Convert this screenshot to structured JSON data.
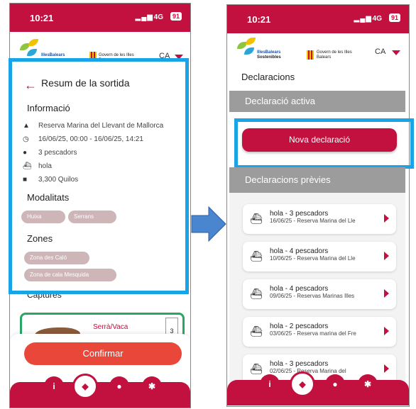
{
  "colors": {
    "brand": "#c2103f",
    "highlight": "#1aa3e6",
    "grey_header": "#9c9c9c",
    "pill": "#cdb5b8",
    "confirm": "#e8473a"
  },
  "left": {
    "status": {
      "time": "10:21",
      "network": "4G",
      "battery": "91"
    },
    "lang": "CA",
    "logo": {
      "name": "IllesBalears",
      "gov": "Govern de les Illes Balears"
    },
    "title": "Resum de la sortida",
    "info_heading": "Informació",
    "info": [
      {
        "icon": "warning-icon",
        "text": "Reserva Marina del Llevant de Mallorca"
      },
      {
        "icon": "clock-icon",
        "text": "16/06/25, 00:00 - 16/06/25, 14:21"
      },
      {
        "icon": "person-icon",
        "text": "3 pescadors"
      },
      {
        "icon": "boat-icon",
        "text": "hola"
      },
      {
        "icon": "bag-icon",
        "text": "3,300 Quilos"
      }
    ],
    "modalitats_heading": "Modalitats",
    "modalitats": [
      "Huixa",
      "Serrans"
    ],
    "zones_heading": "Zones",
    "zones": [
      "Zona des Caló",
      "Zona de cala Mesquida"
    ],
    "captures_heading": "Captures",
    "capture": {
      "name": "Serrà/Vaca",
      "count": "3"
    },
    "confirm_label": "Confirmar"
  },
  "right": {
    "status": {
      "time": "10:21",
      "network": "4G",
      "battery": "91"
    },
    "lang": "CA",
    "logo": {
      "name": "IllesBalears",
      "sub": "Sostenibles",
      "gov": "Govern de les Illes Balears"
    },
    "title": "Declaracions",
    "active_heading": "Declaració activa",
    "new_label": "Nova declaració",
    "previous_heading": "Declaracions prèvies",
    "declarations": [
      {
        "title": "hola - 3 pescadors",
        "detail": "16/06/25 - Reserva Marina del Lle"
      },
      {
        "title": "hola - 4 pescadors",
        "detail": "10/06/25 - Reserva Marina del Lle"
      },
      {
        "title": "hola - 4 pescadors",
        "detail": "09/06/25 - Reservas Marinas Illes"
      },
      {
        "title": "hola - 2 pescadors",
        "detail": "03/06/25 - Reserva marina del Fre"
      },
      {
        "title": "hola - 3 pescadors",
        "detail": "02/06/25 - Reserva Marina del"
      }
    ]
  },
  "nav_icons": [
    "info-icon",
    "fish-icon",
    "person-icon",
    "gear-icon"
  ]
}
